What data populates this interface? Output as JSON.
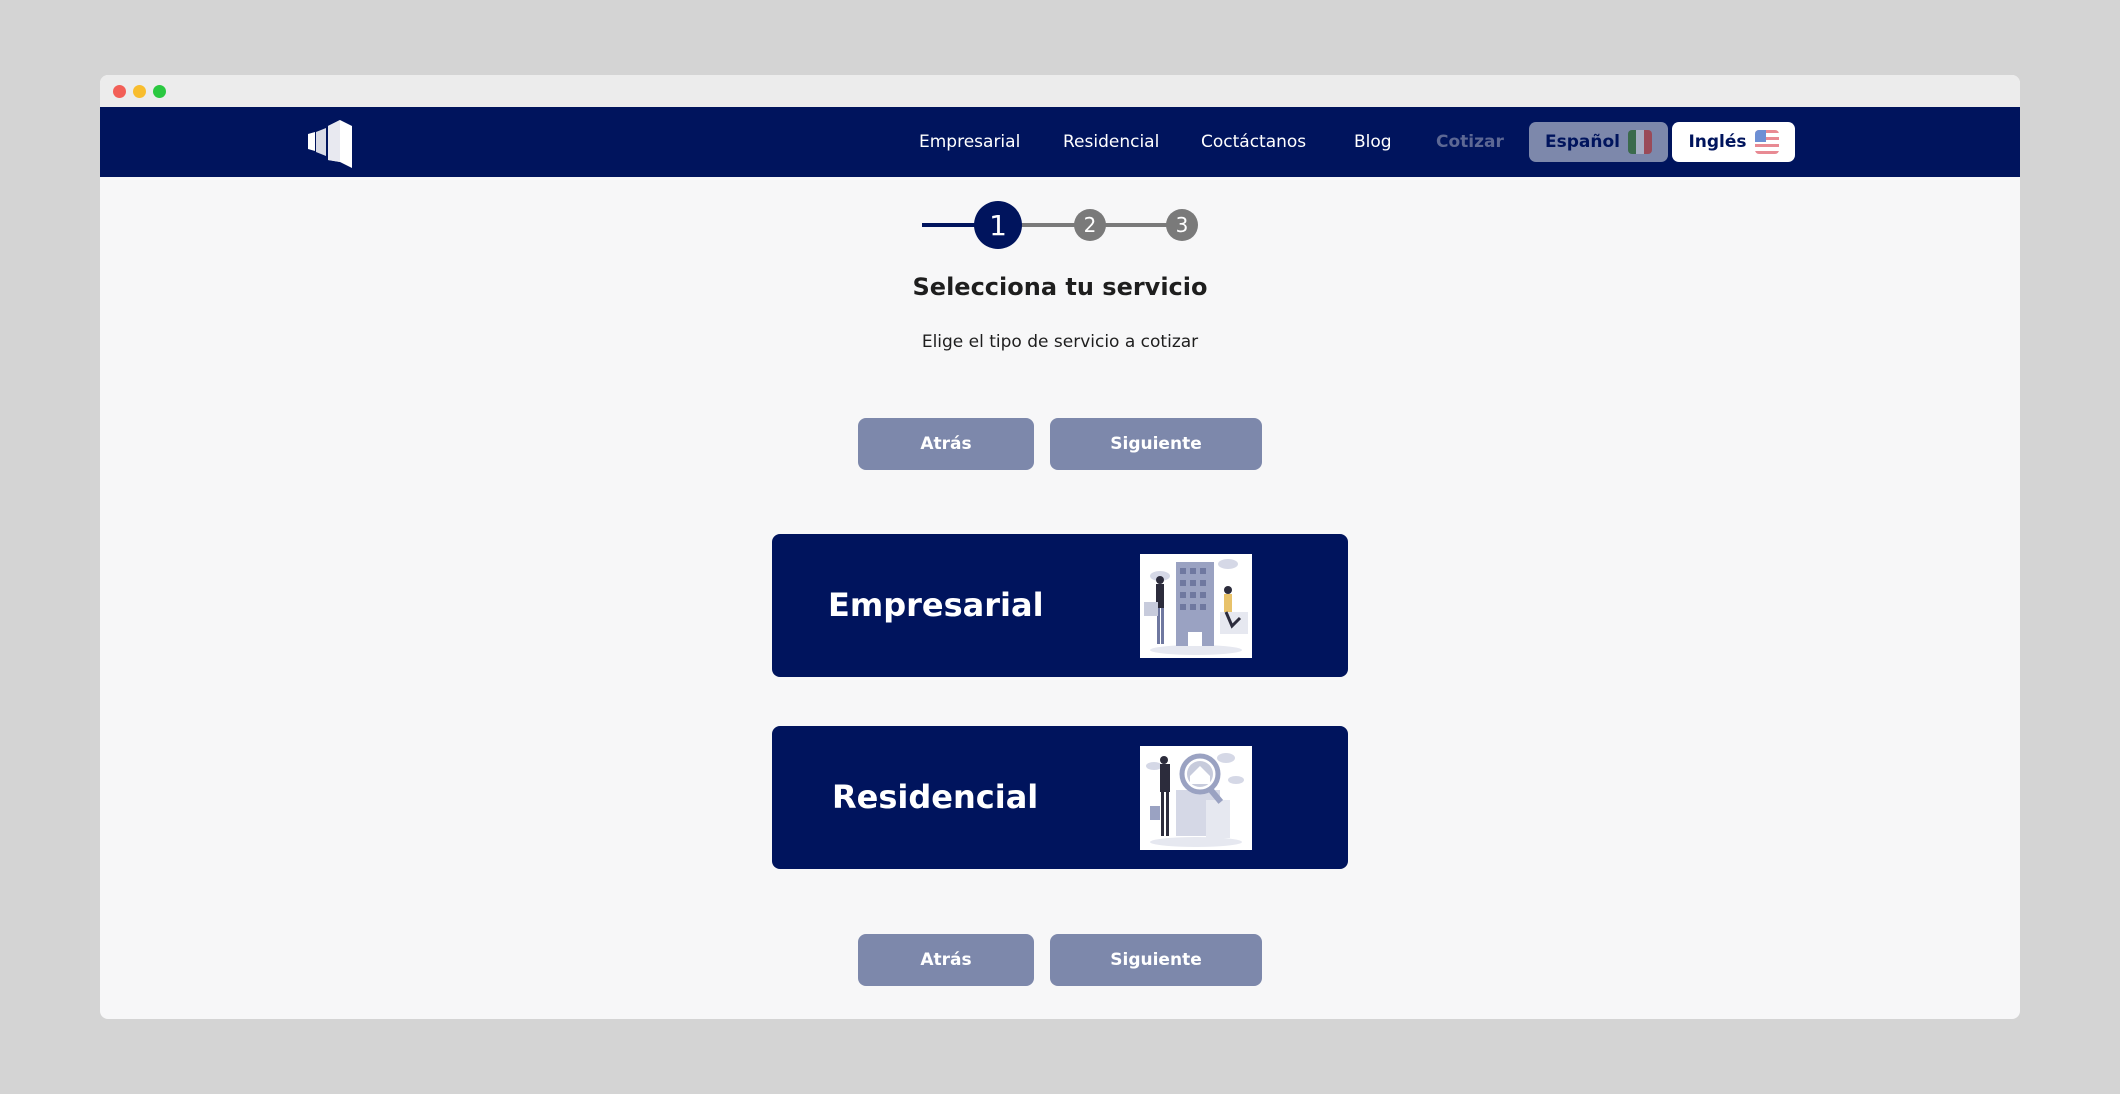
{
  "nav": {
    "links": [
      "Empresarial",
      "Residencial",
      "Coctáctanos",
      "Blog",
      "Cotizar"
    ],
    "active": "Cotizar",
    "languages": [
      {
        "label": "Español",
        "flag": "mexico-flag-icon",
        "selected": true
      },
      {
        "label": "Inglés",
        "flag": "usa-flag-icon",
        "selected": false
      }
    ]
  },
  "stepper": {
    "steps": [
      "1",
      "2",
      "3"
    ],
    "current": 1
  },
  "heading": {
    "title": "Selecciona tu servicio",
    "subtitle": "Elige el tipo de servicio a cotizar"
  },
  "buttons": {
    "back": "Atrás",
    "next": "Siguiente"
  },
  "services": [
    {
      "label": "Empresarial",
      "icon": "office-building-illustration"
    },
    {
      "label": "Residencial",
      "icon": "house-search-illustration"
    }
  ],
  "colors": {
    "brand": "#00145d",
    "muted_button": "#7d88ab",
    "step_inactive": "#7a7a7a",
    "background": "#f7f7f8"
  }
}
